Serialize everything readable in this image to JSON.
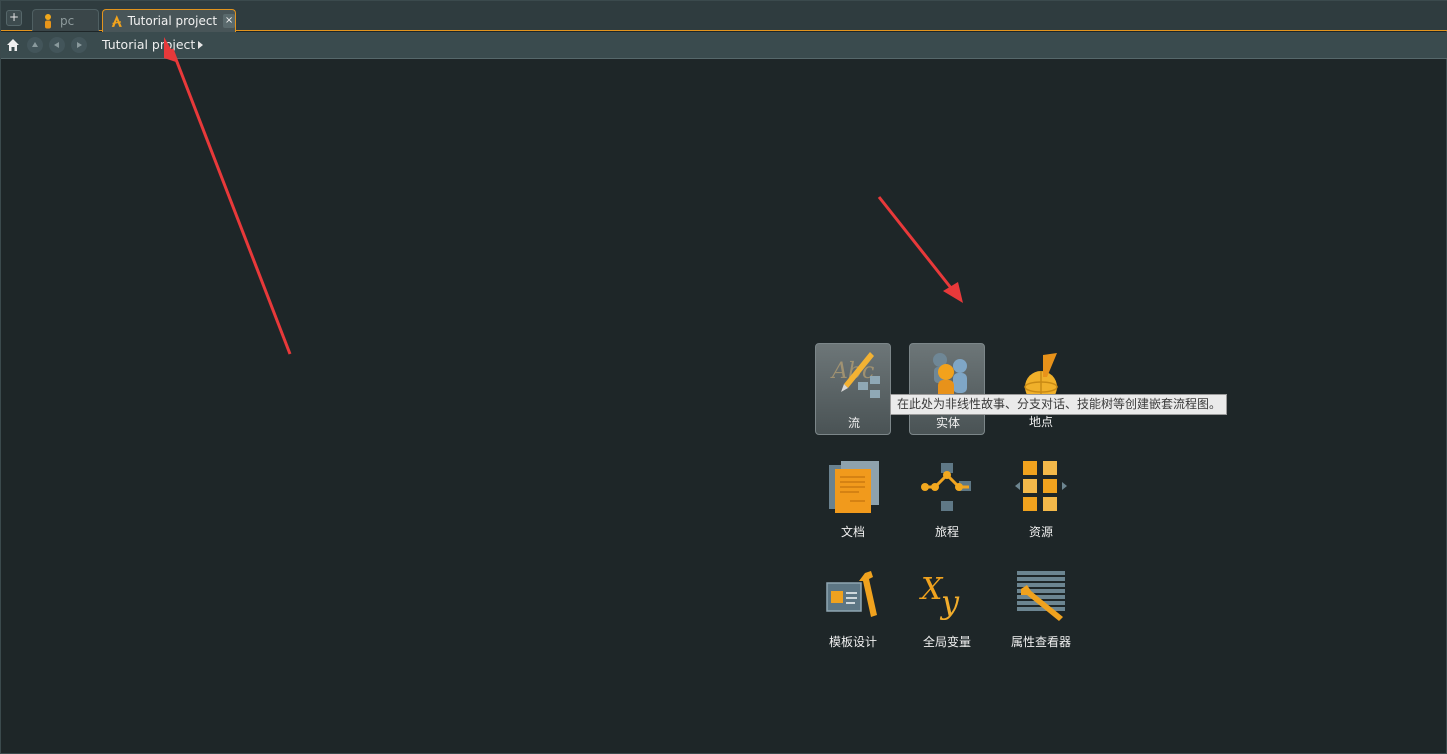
{
  "tabs": [
    {
      "label": "pc",
      "icon": "person-icon",
      "active": false
    },
    {
      "label": "Tutorial project",
      "icon": "project-logo-icon",
      "active": true,
      "close": "×"
    }
  ],
  "add_tab_label": "+",
  "breadcrumb": {
    "path": "Tutorial project"
  },
  "launcher": {
    "items": [
      {
        "label": "流",
        "icon": "flow-icon"
      },
      {
        "label": "实体",
        "icon": "entities-icon"
      },
      {
        "label": "地点",
        "icon": "locations-icon"
      },
      {
        "label": "文档",
        "icon": "documents-icon"
      },
      {
        "label": "旅程",
        "icon": "journeys-icon"
      },
      {
        "label": "资源",
        "icon": "assets-icon"
      },
      {
        "label": "模板设计",
        "icon": "template-design-icon"
      },
      {
        "label": "全局变量",
        "icon": "global-variables-icon"
      },
      {
        "label": "属性查看器",
        "icon": "property-inspector-icon"
      }
    ],
    "tooltip": "在此处为非线性故事、分支对话、技能树等创建嵌套流程图。"
  },
  "colors": {
    "accent": "#e2941e",
    "background": "#1e2628",
    "annotation": "#e8393a"
  }
}
